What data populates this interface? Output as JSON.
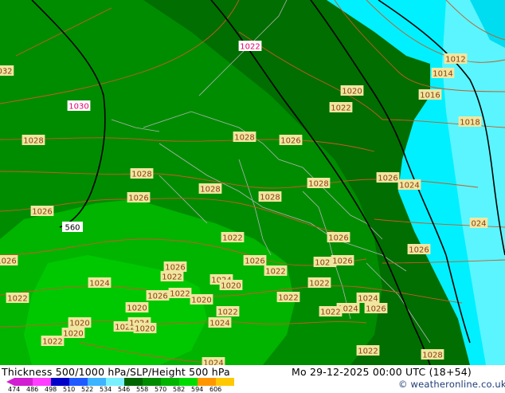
{
  "footer": {
    "title": "Thickness 500/1000 hPa/SLP/Height 500 hPa",
    "datetime": "Mo 29-12-2025 00:00 UTC (18+54)",
    "credit": "© weatheronline.co.uk"
  },
  "legend": {
    "values": [
      "474",
      "486",
      "498",
      "510",
      "522",
      "534",
      "546",
      "558",
      "570",
      "582",
      "594",
      "606"
    ],
    "colors": [
      "#d21ed2",
      "#ff3cff",
      "#0000c8",
      "#1e5aff",
      "#3cb4ff",
      "#78f0ff",
      "#006400",
      "#008c00",
      "#00b400",
      "#00dc00",
      "#ff9600",
      "#ffc800"
    ]
  },
  "map": {
    "colors": {
      "dark_green": "#006e00",
      "mid_green": "#008c00",
      "light_green": "#00b400",
      "brighter_green": "#00c800",
      "cyan": "#00f0ff",
      "light_cyan": "#5af5ff",
      "deep_cyan": "#00dcf0",
      "isobar_line": "#c85a28",
      "height_line": "#000000",
      "border_line": "#b4b4b4",
      "label_bg": "#f0e6a0"
    },
    "pressure_labels": [
      {
        "text": "1022",
        "magenta": true
      },
      {
        "text": "1012"
      },
      {
        "text": "1014"
      },
      {
        "text": "032"
      },
      {
        "text": "1030",
        "magenta": true
      },
      {
        "text": "1020"
      },
      {
        "text": "1016"
      },
      {
        "text": "1022"
      },
      {
        "text": "1018"
      },
      {
        "text": "1028"
      },
      {
        "text": "1028"
      },
      {
        "text": "1026"
      },
      {
        "text": "1028"
      },
      {
        "text": "1026"
      },
      {
        "text": "1024"
      },
      {
        "text": "1026"
      },
      {
        "text": "1028"
      },
      {
        "text": "1028"
      },
      {
        "text": "1028"
      },
      {
        "text": "1026"
      },
      {
        "text": "1022"
      },
      {
        "text": "024"
      },
      {
        "text": "1026"
      },
      {
        "text": "1026"
      },
      {
        "text": "1026"
      },
      {
        "text": "1026"
      },
      {
        "text": "1021"
      },
      {
        "text": "1026"
      },
      {
        "text": "1026"
      },
      {
        "text": "1022"
      },
      {
        "text": "1022"
      },
      {
        "text": "1024"
      },
      {
        "text": "1022"
      },
      {
        "text": "1024"
      },
      {
        "text": "1022"
      },
      {
        "text": "1020"
      },
      {
        "text": "1026"
      },
      {
        "text": "1022"
      },
      {
        "text": "1020"
      },
      {
        "text": "1022"
      },
      {
        "text": "1024"
      },
      {
        "text": "1026"
      },
      {
        "text": "1020"
      },
      {
        "text": "1022"
      },
      {
        "text": "1024"
      },
      {
        "text": "1022"
      },
      {
        "text": "1020"
      },
      {
        "text": "1022"
      },
      {
        "text": "1024"
      },
      {
        "text": "1020"
      },
      {
        "text": "1024"
      },
      {
        "text": "1020"
      },
      {
        "text": "1022"
      },
      {
        "text": "1028"
      },
      {
        "text": "1024"
      },
      {
        "text": "1022"
      }
    ],
    "height_label": "560"
  }
}
